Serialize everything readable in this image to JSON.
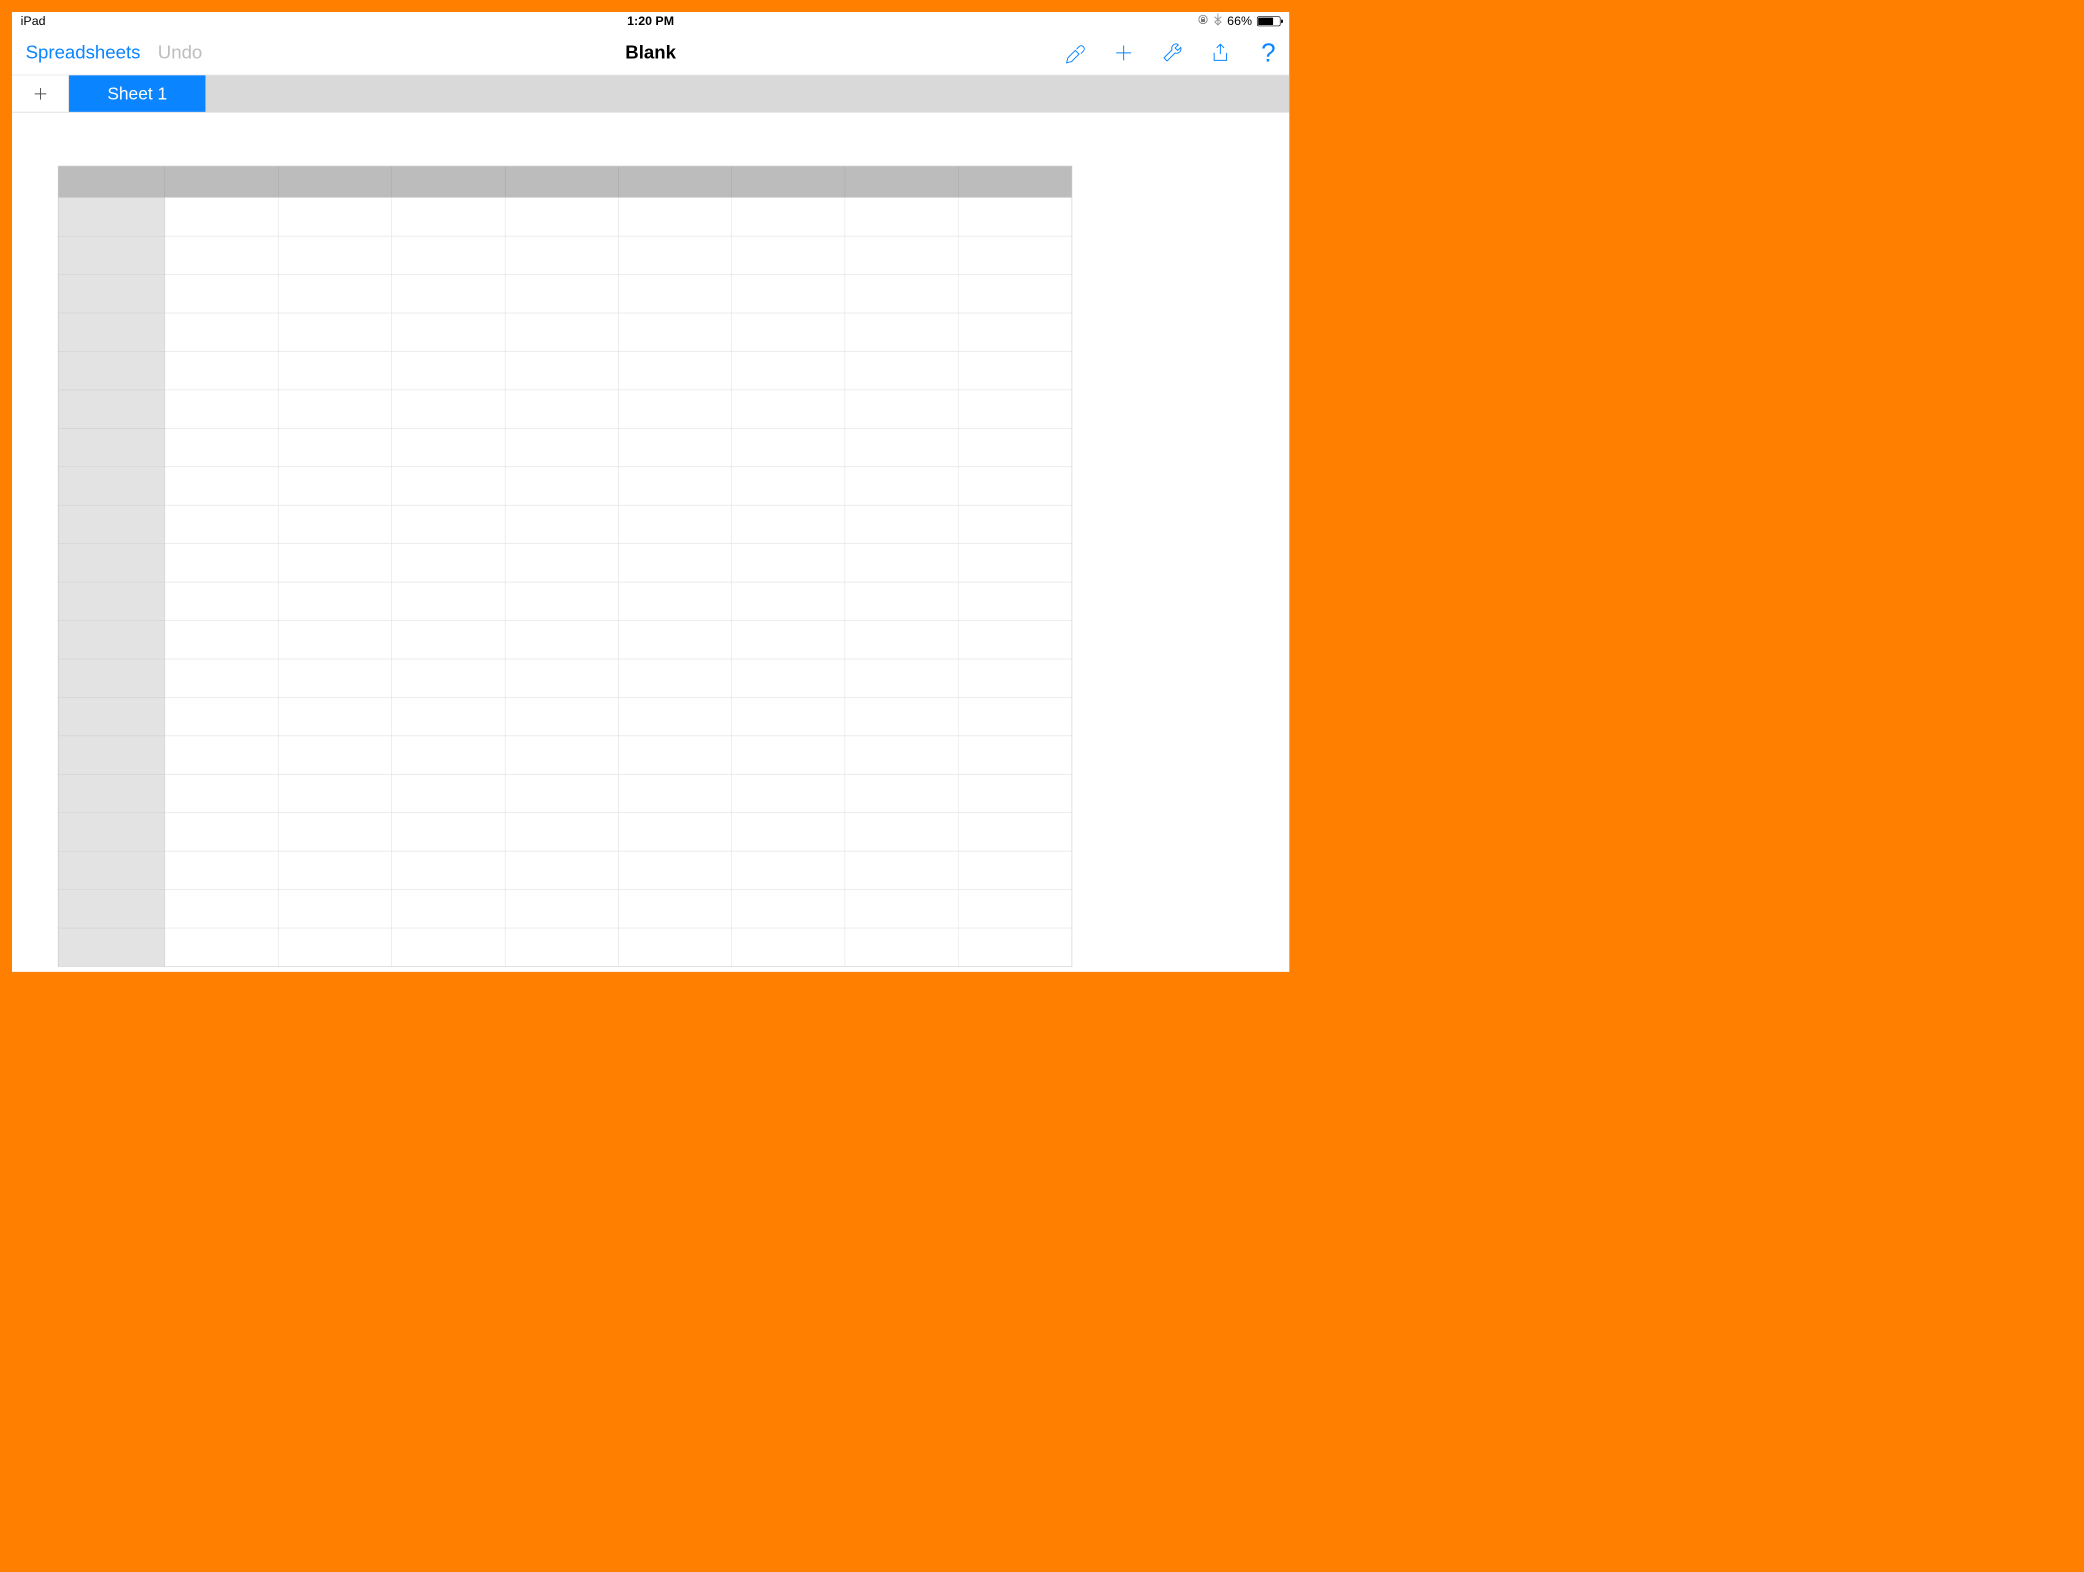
{
  "status": {
    "device": "iPad",
    "time": "1:20 PM",
    "battery_pct": "66%"
  },
  "toolbar": {
    "back_label": "Spreadsheets",
    "undo_label": "Undo",
    "title": "Blank",
    "help_label": "?"
  },
  "tabs": {
    "active": "Sheet 1"
  },
  "grid": {
    "columns": 8,
    "rows": 20
  },
  "icons": {
    "format": "paintbrush-icon",
    "add": "plus-icon",
    "tools": "wrench-icon",
    "share": "share-icon"
  },
  "colors": {
    "accent": "#0a84ff",
    "frame": "#ff7f00"
  }
}
